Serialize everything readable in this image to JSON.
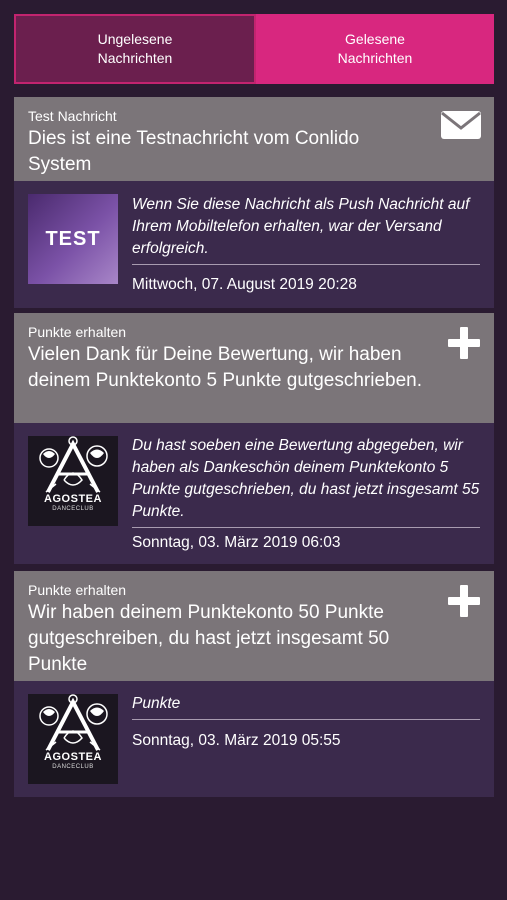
{
  "tabs": {
    "unread_label": "Ungelesene\nNachrichten",
    "read_label": "Gelesene\nNachrichten"
  },
  "messages": [
    {
      "category": "Test Nachricht",
      "subject": "Dies ist eine Testnachricht vom Conlido System",
      "action_icon": "envelope-icon",
      "thumbnail_text": "TEST",
      "text": "Wenn Sie diese Nachricht als Push Nachricht auf Ihrem Mobiltelefon erhalten, war der Versand erfolgreich.",
      "date": "Mittwoch, 07. August 2019 20:28"
    },
    {
      "category": "Punkte erhalten",
      "subject": "Vielen Dank für Deine Bewertung, wir haben deinem Punktekonto 5 Punkte gutgeschrieben.",
      "action_icon": "plus-icon",
      "logo_name": "AGOSTEA",
      "logo_sub": "DANCECLUB",
      "text": "Du hast soeben eine Bewertung abgegeben, wir haben als Dankeschön deinem Punktekonto 5 Punkte gutgeschrieben, du hast jetzt insgesamt 55 Punkte.",
      "date": "Sonntag, 03. März 2019 06:03"
    },
    {
      "category": "Punkte erhalten",
      "subject": "Wir haben deinem Punktekonto 50 Punkte gutgeschreiben, du hast jetzt insgesamt 50 Punkte",
      "action_icon": "plus-icon",
      "logo_name": "AGOSTEA",
      "logo_sub": "DANCECLUB",
      "text": "Punkte",
      "date": "Sonntag, 03. März 2019 05:55"
    }
  ],
  "colors": {
    "background": "#2a1b31",
    "tab_unread": "#6b1f4e",
    "tab_read": "#d8277f",
    "card_header": "#7b7579",
    "card_body": "#3b2a4c"
  }
}
